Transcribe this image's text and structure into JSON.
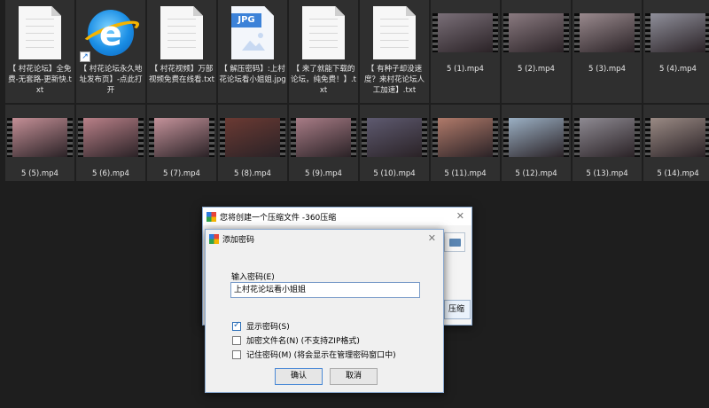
{
  "files_row1": [
    {
      "type": "txt",
      "name": "【 村花论坛】全免费-无套路-更新快.txt"
    },
    {
      "type": "url",
      "name": "【 村花论坛永久地址发布页】-点此打开"
    },
    {
      "type": "txt",
      "name": "【 村花视频】万部视频免费在线看.txt"
    },
    {
      "type": "jpg",
      "name": "【 解压密码】:上村花论坛看小姐姐.jpg",
      "badge": "JPG"
    },
    {
      "type": "txt",
      "name": "【 来了就能下载的论坛，纯免费！】.txt"
    },
    {
      "type": "txt",
      "name": "【 有种子却没速度？来村花论坛人工加速】.txt"
    },
    {
      "type": "video",
      "name": "5 (1).mp4",
      "color": "#7a6f78"
    },
    {
      "type": "video",
      "name": "5 (2).mp4",
      "color": "#8a7a80"
    },
    {
      "type": "video",
      "name": "5 (3).mp4",
      "color": "#9a8a8e"
    },
    {
      "type": "video",
      "name": "5 (4).mp4",
      "color": "#8f8f9a"
    }
  ],
  "files_row2": [
    {
      "type": "video",
      "name": "5 (5).mp4",
      "color": "#c48f96"
    },
    {
      "type": "video",
      "name": "5 (6).mp4",
      "color": "#b98088"
    },
    {
      "type": "video",
      "name": "5 (7).mp4",
      "color": "#c4929a"
    },
    {
      "type": "video",
      "name": "5 (8).mp4",
      "color": "#6b3a33"
    },
    {
      "type": "video",
      "name": "5 (9).mp4",
      "color": "#a87c86"
    },
    {
      "type": "video",
      "name": "5 (10).mp4",
      "color": "#5e5a70"
    },
    {
      "type": "video",
      "name": "5 (11).mp4",
      "color": "#b07a6a"
    },
    {
      "type": "video",
      "name": "5 (12).mp4",
      "color": "#9bb0c4"
    },
    {
      "type": "video",
      "name": "5 (13).mp4",
      "color": "#8e8a92"
    },
    {
      "type": "video",
      "name": "5 (14).mp4",
      "color": "#9a8a84"
    }
  ],
  "outer_dialog": {
    "title": "您将创建一个压缩文件 -360压缩",
    "close_glyph": "✕",
    "partial_button": "压缩"
  },
  "password_dialog": {
    "title": "添加密码",
    "close_glyph": "✕",
    "input_label": "输入密码(E)",
    "input_value": "上村花论坛看小姐姐",
    "options": [
      {
        "label": "显示密码(S)",
        "checked": true
      },
      {
        "label": "加密文件名(N) (不支持ZIP格式)",
        "checked": false
      },
      {
        "label": "记住密码(M) (将会显示在管理密码窗口中)",
        "checked": false
      }
    ],
    "ok_label": "确认",
    "cancel_label": "取消"
  }
}
